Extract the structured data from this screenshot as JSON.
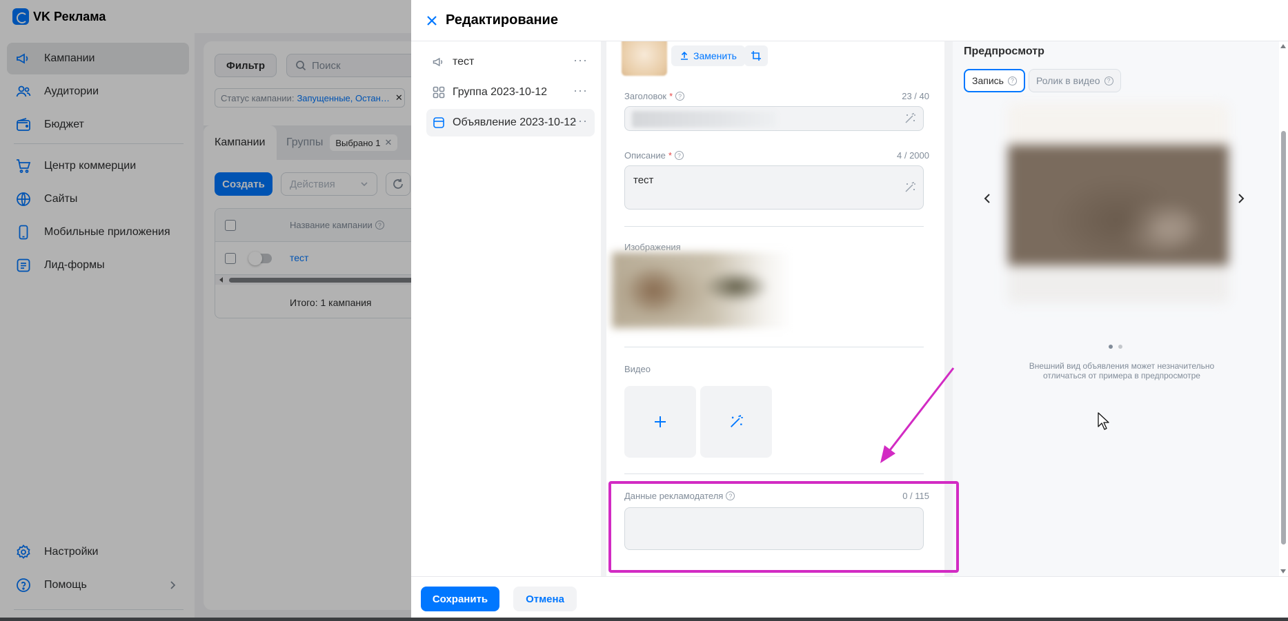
{
  "app": {
    "name": "VK Реклама",
    "sidebar": {
      "items": [
        {
          "label": "Кампании",
          "icon": "megaphone-icon"
        },
        {
          "label": "Аудитории",
          "icon": "users-icon"
        },
        {
          "label": "Бюджет",
          "icon": "wallet-icon"
        },
        {
          "label": "Центр коммерции",
          "icon": "cart-icon"
        },
        {
          "label": "Сайты",
          "icon": "globe-icon"
        },
        {
          "label": "Мобильные приложения",
          "icon": "phone-icon"
        },
        {
          "label": "Лид-формы",
          "icon": "list-icon"
        },
        {
          "label": "Настройки",
          "icon": "gear-icon"
        },
        {
          "label": "Помощь",
          "icon": "help-icon"
        }
      ]
    },
    "toolbar": {
      "filter_label": "Фильтр",
      "search_placeholder": "Поиск",
      "status_filter_label": "Статус кампании:",
      "status_filter_value": "Запущенные, Остан…"
    },
    "tabs": [
      {
        "label": "Кампании"
      },
      {
        "label": "Группы"
      }
    ],
    "selected_badge": "Выбрано 1",
    "create_label": "Создать",
    "actions_placeholder": "Действия",
    "table": {
      "column_name": "Название кампании",
      "rows": [
        {
          "name": "тест"
        }
      ],
      "total": "Итого: 1 кампания"
    }
  },
  "panel": {
    "title": "Редактирование",
    "tree": [
      {
        "label": "тест",
        "icon": "megaphone-icon"
      },
      {
        "label": "Группа 2023-10-12",
        "icon": "grid-icon"
      },
      {
        "label": "Объявление 2023-10-12",
        "icon": "ad-card-icon"
      }
    ],
    "form": {
      "replace_label": "Заменить",
      "headline": {
        "label": "Заголовок",
        "counter": "23 / 40"
      },
      "description": {
        "label": "Описание",
        "counter": "4 / 2000",
        "value": "тест"
      },
      "images_label": "Изображения",
      "video_label": "Видео",
      "advertiser": {
        "label": "Данные рекламодателя",
        "counter": "0 / 115",
        "value": ""
      }
    },
    "preview": {
      "title": "Предпросмотр",
      "tab_post": "Запись",
      "tab_video": "Ролик в видео",
      "note": "Внешний вид объявления может незначительно отличаться от примера в предпросмотре"
    },
    "footer": {
      "save_label": "Сохранить",
      "cancel_label": "Отмена"
    }
  },
  "colors": {
    "accent": "#0077ff",
    "annotation": "#d22bc3",
    "required": "#e64646"
  }
}
